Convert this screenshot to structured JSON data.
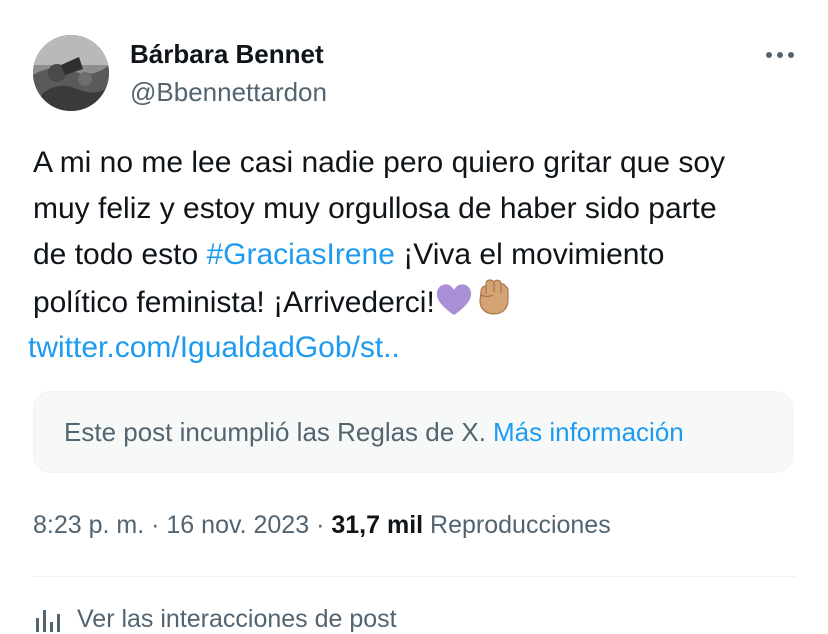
{
  "author": {
    "display_name": "Bárbara Bennet",
    "handle": "@Bbennettardon",
    "avatar_icon": "avatar-photo"
  },
  "more_icon": "more-horizontal-icon",
  "tweet": {
    "line1": "A mi no me lee casi nadie pero quiero gritar que soy",
    "line2": "muy feliz y estoy muy orgullosa de haber sido parte",
    "line3_prefix": "de todo esto ",
    "hashtag": "#GraciasIrene",
    "line3_suffix": " ¡Viva el movimiento",
    "line4": "político feminista! ¡Arrivederci!",
    "emojis": [
      "purple-heart",
      "raised-fist-medium-skin-tone"
    ],
    "link": "twitter.com/IgualdadGob/st.."
  },
  "notice": {
    "text": "Este post incumplió las Reglas de X.",
    "link": "Más información"
  },
  "meta": {
    "time": "8:23 p. m.",
    "separator": "·",
    "date": "16 nov. 2023",
    "views_count": "31,7 mil",
    "views_label": "Reproducciones"
  },
  "interactions": {
    "label": "Ver las interacciones de post",
    "icon": "analytics-icon"
  },
  "colors": {
    "link": "#1d9bf0",
    "text_primary": "#0f1419",
    "text_secondary": "#536471",
    "notice_bg": "#f7f9f9",
    "purple_heart": "#aa8ed6",
    "fist_skin": "#d4a373"
  }
}
